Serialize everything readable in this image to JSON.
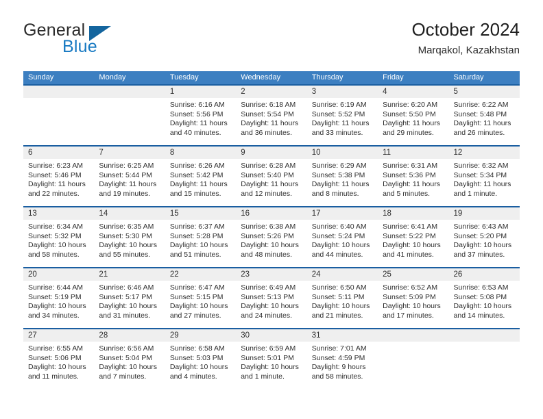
{
  "brand": {
    "word_one": "General",
    "word_two": "Blue",
    "triangle_color": "#14659e",
    "blue_color": "#1779c2"
  },
  "header": {
    "title": "October 2024",
    "subtitle": "Marqakol, Kazakhstan"
  },
  "theme": {
    "header_row_bg": "#3c7fc1",
    "week_divider": "#1a5ea1",
    "day_number_bg": "#efefef"
  },
  "weekdays": [
    "Sunday",
    "Monday",
    "Tuesday",
    "Wednesday",
    "Thursday",
    "Friday",
    "Saturday"
  ],
  "weeks": [
    [
      {
        "day": "",
        "sunrise": "",
        "sunset": "",
        "daylight": ""
      },
      {
        "day": "",
        "sunrise": "",
        "sunset": "",
        "daylight": ""
      },
      {
        "day": "1",
        "sunrise": "Sunrise: 6:16 AM",
        "sunset": "Sunset: 5:56 PM",
        "daylight": "Daylight: 11 hours and 40 minutes."
      },
      {
        "day": "2",
        "sunrise": "Sunrise: 6:18 AM",
        "sunset": "Sunset: 5:54 PM",
        "daylight": "Daylight: 11 hours and 36 minutes."
      },
      {
        "day": "3",
        "sunrise": "Sunrise: 6:19 AM",
        "sunset": "Sunset: 5:52 PM",
        "daylight": "Daylight: 11 hours and 33 minutes."
      },
      {
        "day": "4",
        "sunrise": "Sunrise: 6:20 AM",
        "sunset": "Sunset: 5:50 PM",
        "daylight": "Daylight: 11 hours and 29 minutes."
      },
      {
        "day": "5",
        "sunrise": "Sunrise: 6:22 AM",
        "sunset": "Sunset: 5:48 PM",
        "daylight": "Daylight: 11 hours and 26 minutes."
      }
    ],
    [
      {
        "day": "6",
        "sunrise": "Sunrise: 6:23 AM",
        "sunset": "Sunset: 5:46 PM",
        "daylight": "Daylight: 11 hours and 22 minutes."
      },
      {
        "day": "7",
        "sunrise": "Sunrise: 6:25 AM",
        "sunset": "Sunset: 5:44 PM",
        "daylight": "Daylight: 11 hours and 19 minutes."
      },
      {
        "day": "8",
        "sunrise": "Sunrise: 6:26 AM",
        "sunset": "Sunset: 5:42 PM",
        "daylight": "Daylight: 11 hours and 15 minutes."
      },
      {
        "day": "9",
        "sunrise": "Sunrise: 6:28 AM",
        "sunset": "Sunset: 5:40 PM",
        "daylight": "Daylight: 11 hours and 12 minutes."
      },
      {
        "day": "10",
        "sunrise": "Sunrise: 6:29 AM",
        "sunset": "Sunset: 5:38 PM",
        "daylight": "Daylight: 11 hours and 8 minutes."
      },
      {
        "day": "11",
        "sunrise": "Sunrise: 6:31 AM",
        "sunset": "Sunset: 5:36 PM",
        "daylight": "Daylight: 11 hours and 5 minutes."
      },
      {
        "day": "12",
        "sunrise": "Sunrise: 6:32 AM",
        "sunset": "Sunset: 5:34 PM",
        "daylight": "Daylight: 11 hours and 1 minute."
      }
    ],
    [
      {
        "day": "13",
        "sunrise": "Sunrise: 6:34 AM",
        "sunset": "Sunset: 5:32 PM",
        "daylight": "Daylight: 10 hours and 58 minutes."
      },
      {
        "day": "14",
        "sunrise": "Sunrise: 6:35 AM",
        "sunset": "Sunset: 5:30 PM",
        "daylight": "Daylight: 10 hours and 55 minutes."
      },
      {
        "day": "15",
        "sunrise": "Sunrise: 6:37 AM",
        "sunset": "Sunset: 5:28 PM",
        "daylight": "Daylight: 10 hours and 51 minutes."
      },
      {
        "day": "16",
        "sunrise": "Sunrise: 6:38 AM",
        "sunset": "Sunset: 5:26 PM",
        "daylight": "Daylight: 10 hours and 48 minutes."
      },
      {
        "day": "17",
        "sunrise": "Sunrise: 6:40 AM",
        "sunset": "Sunset: 5:24 PM",
        "daylight": "Daylight: 10 hours and 44 minutes."
      },
      {
        "day": "18",
        "sunrise": "Sunrise: 6:41 AM",
        "sunset": "Sunset: 5:22 PM",
        "daylight": "Daylight: 10 hours and 41 minutes."
      },
      {
        "day": "19",
        "sunrise": "Sunrise: 6:43 AM",
        "sunset": "Sunset: 5:20 PM",
        "daylight": "Daylight: 10 hours and 37 minutes."
      }
    ],
    [
      {
        "day": "20",
        "sunrise": "Sunrise: 6:44 AM",
        "sunset": "Sunset: 5:19 PM",
        "daylight": "Daylight: 10 hours and 34 minutes."
      },
      {
        "day": "21",
        "sunrise": "Sunrise: 6:46 AM",
        "sunset": "Sunset: 5:17 PM",
        "daylight": "Daylight: 10 hours and 31 minutes."
      },
      {
        "day": "22",
        "sunrise": "Sunrise: 6:47 AM",
        "sunset": "Sunset: 5:15 PM",
        "daylight": "Daylight: 10 hours and 27 minutes."
      },
      {
        "day": "23",
        "sunrise": "Sunrise: 6:49 AM",
        "sunset": "Sunset: 5:13 PM",
        "daylight": "Daylight: 10 hours and 24 minutes."
      },
      {
        "day": "24",
        "sunrise": "Sunrise: 6:50 AM",
        "sunset": "Sunset: 5:11 PM",
        "daylight": "Daylight: 10 hours and 21 minutes."
      },
      {
        "day": "25",
        "sunrise": "Sunrise: 6:52 AM",
        "sunset": "Sunset: 5:09 PM",
        "daylight": "Daylight: 10 hours and 17 minutes."
      },
      {
        "day": "26",
        "sunrise": "Sunrise: 6:53 AM",
        "sunset": "Sunset: 5:08 PM",
        "daylight": "Daylight: 10 hours and 14 minutes."
      }
    ],
    [
      {
        "day": "27",
        "sunrise": "Sunrise: 6:55 AM",
        "sunset": "Sunset: 5:06 PM",
        "daylight": "Daylight: 10 hours and 11 minutes."
      },
      {
        "day": "28",
        "sunrise": "Sunrise: 6:56 AM",
        "sunset": "Sunset: 5:04 PM",
        "daylight": "Daylight: 10 hours and 7 minutes."
      },
      {
        "day": "29",
        "sunrise": "Sunrise: 6:58 AM",
        "sunset": "Sunset: 5:03 PM",
        "daylight": "Daylight: 10 hours and 4 minutes."
      },
      {
        "day": "30",
        "sunrise": "Sunrise: 6:59 AM",
        "sunset": "Sunset: 5:01 PM",
        "daylight": "Daylight: 10 hours and 1 minute."
      },
      {
        "day": "31",
        "sunrise": "Sunrise: 7:01 AM",
        "sunset": "Sunset: 4:59 PM",
        "daylight": "Daylight: 9 hours and 58 minutes."
      },
      {
        "day": "",
        "sunrise": "",
        "sunset": "",
        "daylight": ""
      },
      {
        "day": "",
        "sunrise": "",
        "sunset": "",
        "daylight": ""
      }
    ]
  ]
}
